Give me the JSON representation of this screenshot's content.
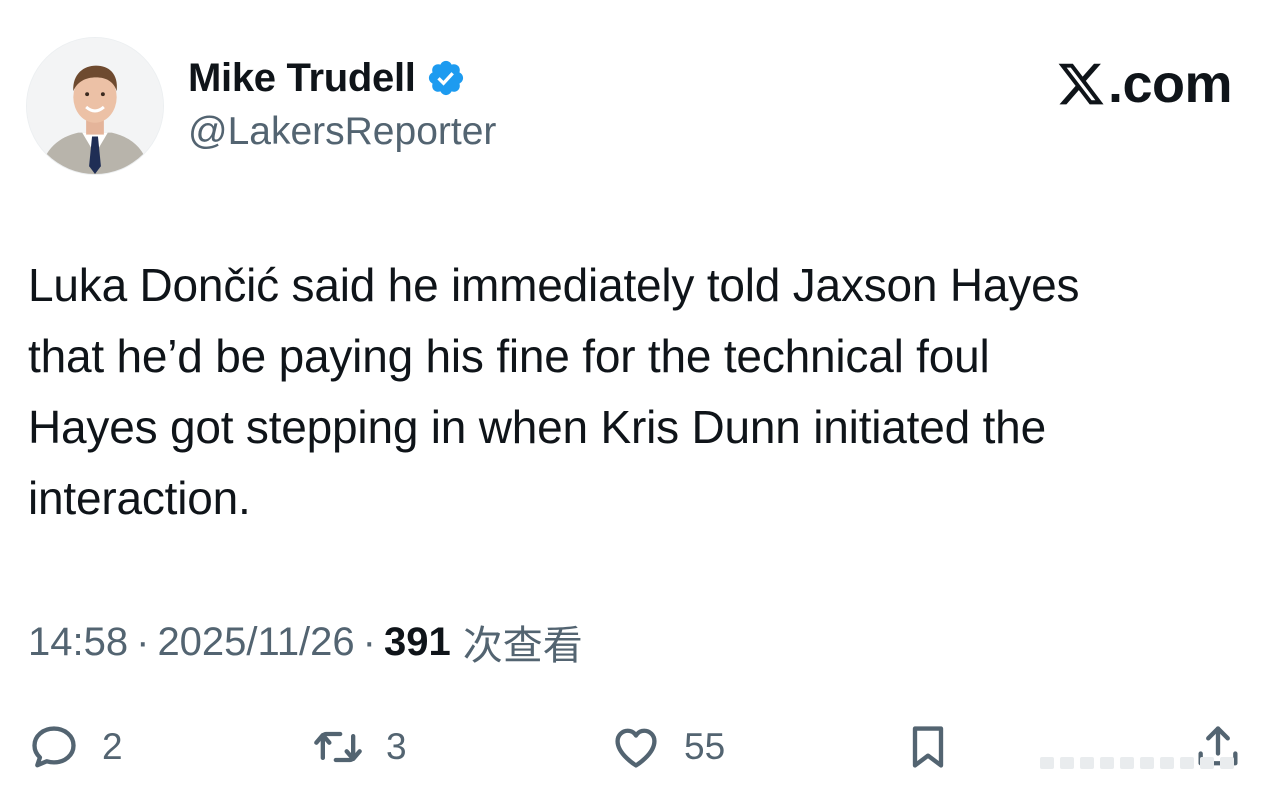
{
  "author": {
    "display_name": "Mike Trudell",
    "handle": "@LakersReporter",
    "verified": true,
    "avatar_icon": "avatar-photo"
  },
  "brand": {
    "text": ".com",
    "logo_icon": "x-logo-icon"
  },
  "tweet": {
    "lines": [
      "Luka Dončić said he immediately told Jaxson Hayes",
      "that he’d be paying his fine for the technical foul",
      "Hayes got stepping in when Kris Dunn initiated the",
      "interaction."
    ]
  },
  "meta": {
    "time": "14:58",
    "separator": "·",
    "date": "2025/11/26",
    "views": "391",
    "views_label": "次查看"
  },
  "actions": {
    "reply": {
      "icon": "reply-icon",
      "count": "2"
    },
    "retweet": {
      "icon": "retweet-icon",
      "count": "3"
    },
    "like": {
      "icon": "heart-icon",
      "count": "55"
    },
    "bookmark": {
      "icon": "bookmark-icon"
    },
    "share": {
      "icon": "share-icon"
    }
  },
  "colors": {
    "text_primary": "#0f1419",
    "text_secondary": "#536471",
    "verified_blue": "#1d9bf0",
    "background": "#ffffff"
  }
}
